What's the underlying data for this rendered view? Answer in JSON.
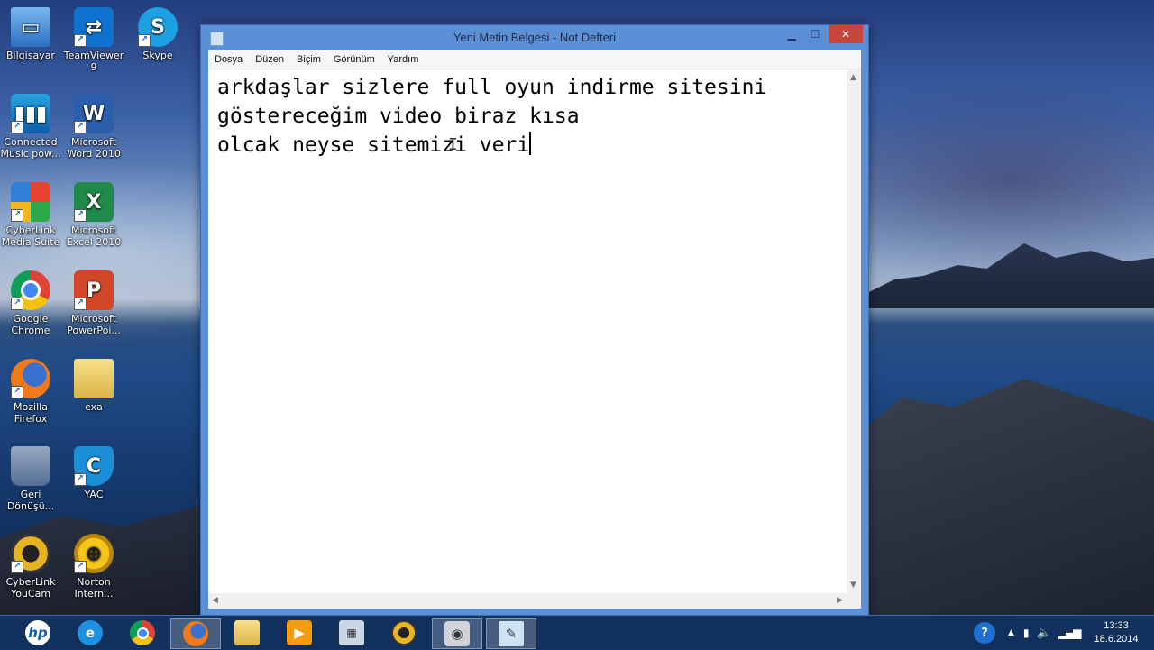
{
  "desktop": {
    "icons": [
      {
        "label": "Bilgisayar",
        "icon": "computer-icon"
      },
      {
        "label": "TeamViewer\n9",
        "icon": "teamviewer-icon"
      },
      {
        "label": "Skype",
        "icon": "skype-icon"
      },
      {
        "label": "Connected\nMusic pow...",
        "icon": "music-equalizer-icon"
      },
      {
        "label": "Microsoft\nWord 2010",
        "icon": "word-icon"
      },
      {
        "label": "CyberLink\nMedia Suite",
        "icon": "puzzle-icon"
      },
      {
        "label": "Microsoft\nExcel 2010",
        "icon": "excel-icon"
      },
      {
        "label": "Google\nChrome",
        "icon": "chrome-icon"
      },
      {
        "label": "Microsoft\nPowerPoi...",
        "icon": "powerpoint-icon"
      },
      {
        "label": "Mozilla\nFirefox",
        "icon": "firefox-icon"
      },
      {
        "label": "exa",
        "icon": "folder-icon"
      },
      {
        "label": "Geri\nDönüşü...",
        "icon": "recycle-bin-icon"
      },
      {
        "label": "YAC",
        "icon": "yac-shield-icon"
      },
      {
        "label": "CyberLink\nYouCam",
        "icon": "webcam-icon"
      },
      {
        "label": "Norton\nIntern...",
        "icon": "norton-globe-icon"
      }
    ]
  },
  "window": {
    "title": "Yeni Metin Belgesi - Not Defteri",
    "minimize": "▁",
    "maximize": "☐",
    "close": "✕",
    "menu": [
      "Dosya",
      "Düzen",
      "Biçim",
      "Görünüm",
      "Yardım"
    ],
    "content_lines": [
      "arkdaşlar sizlere full oyun indirme sitesini",
      "göstereceğim video biraz kısa",
      "olcak neyse sitemizi veri"
    ]
  },
  "taskbar": {
    "apps": [
      "hp-icon",
      "internet-explorer-icon",
      "chrome-icon",
      "firefox-icon",
      "file-explorer-icon",
      "media-player-icon",
      "calculator-icon",
      "cyberlink-youcam-icon",
      "camera-icon",
      "notepad-icon"
    ],
    "tray": {
      "help": "?",
      "time": "13:33",
      "date": "18.6.2014"
    }
  }
}
